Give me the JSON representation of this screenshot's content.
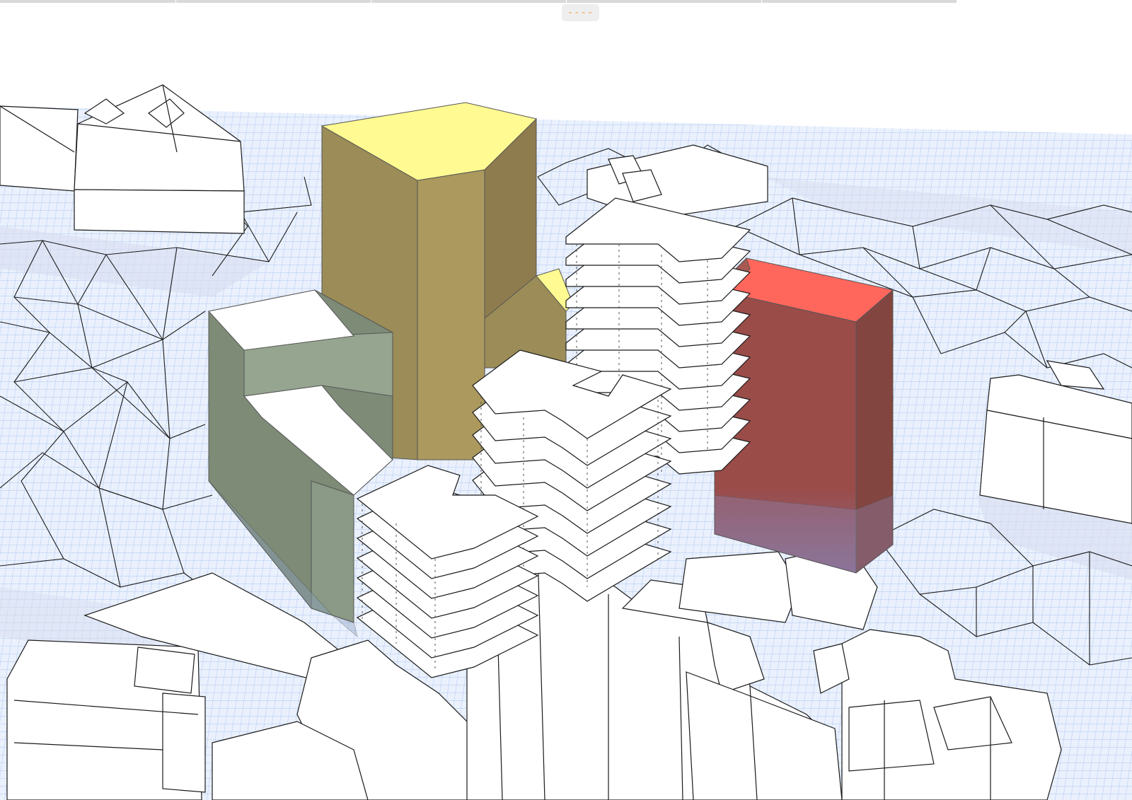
{
  "toolbar": {
    "handle_glyph": "----"
  },
  "colors": {
    "ground_fill": "#eaf1fd",
    "ground_grid": "#9ab8ea",
    "edge": "#1a1a1a",
    "existing_building": "#ffffff",
    "volume_yellow_roof": "#fffa91",
    "volume_yellow_side_light": "#ab995e",
    "volume_yellow_side_dark": "#8e7c4e",
    "volume_green_top": "#ffffff",
    "volume_green_side": "#8a9a86",
    "volume_red_roof": "#ff665c",
    "volume_red_side": "#9a4c49",
    "floor_slab": "#ffffff",
    "handle_accent": "#f0a050"
  }
}
